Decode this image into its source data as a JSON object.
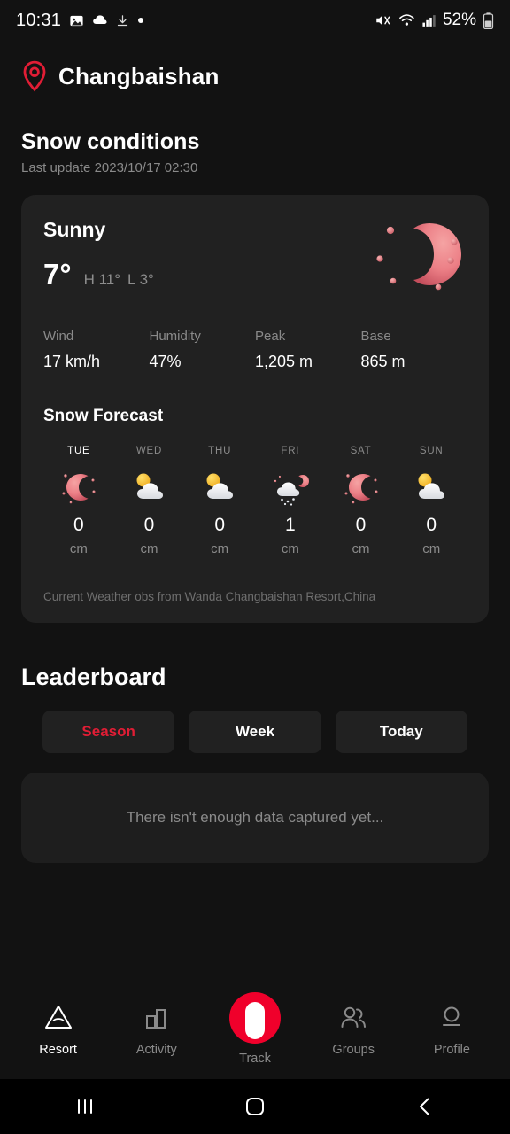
{
  "status_bar": {
    "time": "10:31",
    "battery_percent": "52%",
    "left_icons": [
      "image-icon",
      "cloud-icon",
      "download-icon",
      "dot-icon"
    ],
    "right_icons": [
      "mute-icon",
      "wifi-icon",
      "signal-icon",
      "battery-icon"
    ]
  },
  "header": {
    "location_icon": "location-pin-icon",
    "location": "Changbaishan"
  },
  "snow_conditions": {
    "title": "Snow conditions",
    "last_update": "Last update 2023/10/17 02:30",
    "condition": "Sunny",
    "condition_icon": "moon-stars-icon",
    "temperature": "7°",
    "high": "H 11°",
    "low": "L 3°",
    "stats": [
      {
        "label": "Wind",
        "value": "17 km/h"
      },
      {
        "label": "Humidity",
        "value": "47%"
      },
      {
        "label": "Peak",
        "value": "1,205 m"
      },
      {
        "label": "Base",
        "value": "865 m"
      }
    ],
    "forecast_title": "Snow Forecast",
    "forecast": [
      {
        "day": "TUE",
        "icon": "moon-stars-icon",
        "value": "0",
        "unit": "cm",
        "active": true
      },
      {
        "day": "WED",
        "icon": "sun-cloud-icon",
        "value": "0",
        "unit": "cm",
        "active": false
      },
      {
        "day": "THU",
        "icon": "sun-cloud-icon",
        "value": "0",
        "unit": "cm",
        "active": false
      },
      {
        "day": "FRI",
        "icon": "snow-cloud-moon-icon",
        "value": "1",
        "unit": "cm",
        "active": false
      },
      {
        "day": "SAT",
        "icon": "moon-stars-icon",
        "value": "0",
        "unit": "cm",
        "active": false
      },
      {
        "day": "SUN",
        "icon": "sun-cloud-icon",
        "value": "0",
        "unit": "cm",
        "active": false
      }
    ],
    "footnote": "Current Weather obs from Wanda Changbaishan Resort,China"
  },
  "leaderboard": {
    "title": "Leaderboard",
    "tabs": [
      {
        "label": "Season",
        "active": true
      },
      {
        "label": "Week",
        "active": false
      },
      {
        "label": "Today",
        "active": false
      }
    ],
    "empty_message": "There isn't enough data captured yet..."
  },
  "bottom_nav": [
    {
      "label": "Resort",
      "icon": "mountain-icon",
      "active": true
    },
    {
      "label": "Activity",
      "icon": "bar-chart-icon",
      "active": false
    },
    {
      "label": "Track",
      "icon": "track-icon",
      "active": false
    },
    {
      "label": "Groups",
      "icon": "people-icon",
      "active": false
    },
    {
      "label": "Profile",
      "icon": "person-icon",
      "active": false
    }
  ],
  "system_nav": [
    {
      "icon": "recents-icon"
    },
    {
      "icon": "home-icon"
    },
    {
      "icon": "back-icon"
    }
  ],
  "colors": {
    "background": "#121212",
    "card": "#212121",
    "accent_red": "#e11d35",
    "track_red": "#f0002b",
    "muted_text": "#8a8a8a"
  }
}
